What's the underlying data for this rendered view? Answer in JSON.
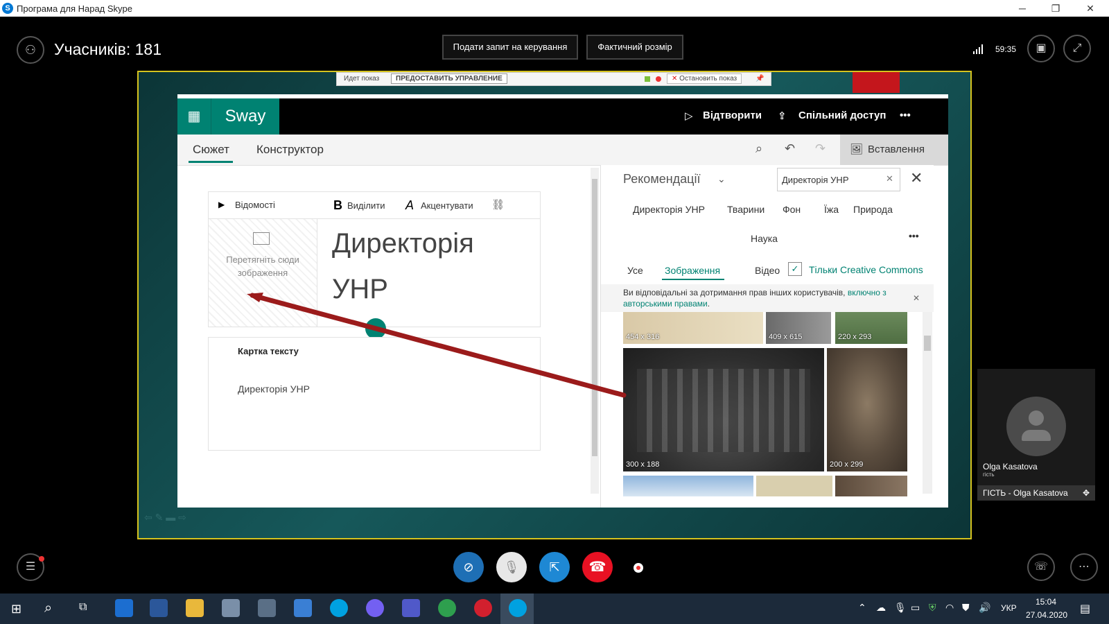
{
  "titlebar": {
    "title": "Програма для Нарад Skype",
    "minimize": "─",
    "restore": "❐",
    "close": "✕"
  },
  "meeting": {
    "participants_label": "Учасників: 181",
    "request_control": "Подати запит на керування",
    "actual_size": "Фактичний розмір",
    "timer": "59:35"
  },
  "sharebar": {
    "status": "Идет показ",
    "give_control": "ПРЕДОСТАВИТЬ УПРАВЛЕНИЕ",
    "stop": "Остановить показ"
  },
  "sway": {
    "brand": "Sway",
    "play": "Відтворити",
    "share": "Спільний доступ",
    "more": "•••",
    "tabs": [
      "Сюжет",
      "Конструктор"
    ],
    "insert": "Вставлення",
    "card1": {
      "details": "Відомості",
      "bold": "Виділити",
      "accent": "Акцентувати",
      "drop_text": "Перетягніть сюди зображення",
      "title_line1": "Директорія",
      "title_line2": "УНР"
    },
    "card2": {
      "label": "Картка тексту",
      "text": "Директорія УНР"
    }
  },
  "recommend": {
    "title": "Рекомендації",
    "search_value": "Директорія УНР",
    "chips": [
      "Директорія УНР",
      "Тварини",
      "Фон",
      "Їжа",
      "Природа"
    ],
    "chip2": "Наука",
    "filters": [
      "Усе",
      "Зображення",
      "Відео"
    ],
    "cc_label": "Тільки Creative Commons",
    "notice_text": "Ви відповідальні за дотримання прав інших користувачів,",
    "notice_link1": "включно з",
    "notice_link2": "авторськими правами",
    "notice_end": ".",
    "thumbs_top": [
      "454 x 316",
      "409 x 615",
      "220 x 293"
    ],
    "thumbs_mid": [
      "300 x 188",
      "200 x 299"
    ]
  },
  "tile": {
    "name": "Olga Kasatova",
    "role": "гість",
    "label": "ГІСТЬ - Olga Kasatova"
  },
  "tray": {
    "lang": "УКР",
    "time": "15:04",
    "date": "27.04.2020"
  },
  "colors": {
    "sway_teal": "#008272",
    "share_border": "#d6c31e",
    "end_call": "#e81123",
    "skype_blue": "#0078d4"
  }
}
